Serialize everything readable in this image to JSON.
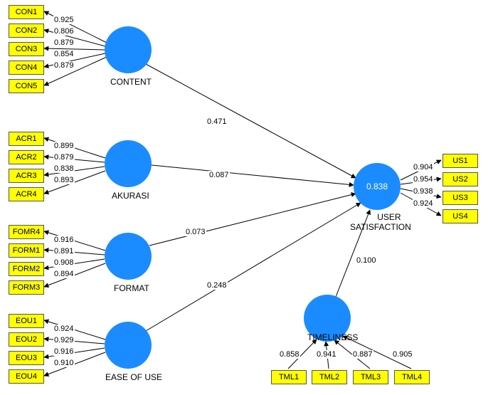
{
  "chart_data": {
    "type": "path-diagram",
    "latent_vars": [
      {
        "id": "content",
        "label": "CONTENT",
        "indicators": [
          {
            "name": "CON1",
            "loading": 0.925
          },
          {
            "name": "CON2",
            "loading": 0.806
          },
          {
            "name": "CON3",
            "loading": 0.879
          },
          {
            "name": "CON4",
            "loading": 0.854
          },
          {
            "name": "CON5",
            "loading": 0.879
          }
        ]
      },
      {
        "id": "akurasi",
        "label": "AKURASI",
        "indicators": [
          {
            "name": "ACR1",
            "loading": 0.899
          },
          {
            "name": "ACR2",
            "loading": 0.879
          },
          {
            "name": "ACR3",
            "loading": 0.838
          },
          {
            "name": "ACR4",
            "loading": 0.893
          }
        ]
      },
      {
        "id": "format",
        "label": "FORMAT",
        "indicators": [
          {
            "name": "FOMR4",
            "loading": 0.916
          },
          {
            "name": "FORM1",
            "loading": 0.891
          },
          {
            "name": "FORM2",
            "loading": 0.908
          },
          {
            "name": "FORM3",
            "loading": 0.894
          }
        ]
      },
      {
        "id": "ease_of_use",
        "label": "EASE OF USE",
        "indicators": [
          {
            "name": "EOU1",
            "loading": 0.924
          },
          {
            "name": "EOU2",
            "loading": 0.929
          },
          {
            "name": "EOU3",
            "loading": 0.916
          },
          {
            "name": "EOU4",
            "loading": 0.91
          }
        ]
      },
      {
        "id": "timeliness",
        "label": "TIMELINESS",
        "indicators": [
          {
            "name": "TML1",
            "loading": 0.858
          },
          {
            "name": "TML2",
            "loading": 0.941
          },
          {
            "name": "TML3",
            "loading": 0.887
          },
          {
            "name": "TML4",
            "loading": 0.905
          }
        ]
      },
      {
        "id": "user_satisfaction",
        "label": "USER SATISFACTION",
        "r2": 0.838,
        "indicators": [
          {
            "name": "US1",
            "loading": 0.904
          },
          {
            "name": "US2",
            "loading": 0.954
          },
          {
            "name": "US3",
            "loading": 0.938
          },
          {
            "name": "US4",
            "loading": 0.924
          }
        ]
      }
    ],
    "paths": [
      {
        "from": "content",
        "to": "user_satisfaction",
        "coef": 0.471
      },
      {
        "from": "akurasi",
        "to": "user_satisfaction",
        "coef": 0.087
      },
      {
        "from": "format",
        "to": "user_satisfaction",
        "coef": 0.073
      },
      {
        "from": "ease_of_use",
        "to": "user_satisfaction",
        "coef": 0.248
      },
      {
        "from": "timeliness",
        "to": "user_satisfaction",
        "coef": 0.1
      }
    ]
  },
  "labels": {
    "content": "CONTENT",
    "akurasi": "AKURASI",
    "format": "FORMAT",
    "ease_of_use": "EASE OF USE",
    "timeliness": "TIMELINESS",
    "user_satisfaction_line1": "USER",
    "user_satisfaction_line2": "SATISFACTION"
  },
  "r2": {
    "user_satisfaction": "0.838"
  },
  "indicators": {
    "CON1": "CON1",
    "CON2": "CON2",
    "CON3": "CON3",
    "CON4": "CON4",
    "CON5": "CON5",
    "ACR1": "ACR1",
    "ACR2": "ACR2",
    "ACR3": "ACR3",
    "ACR4": "ACR4",
    "FOMR4": "FOMR4",
    "FORM1": "FORM1",
    "FORM2": "FORM2",
    "FORM3": "FORM3",
    "EOU1": "EOU1",
    "EOU2": "EOU2",
    "EOU3": "EOU3",
    "EOU4": "EOU4",
    "TML1": "TML1",
    "TML2": "TML2",
    "TML3": "TML3",
    "TML4": "TML4",
    "US1": "US1",
    "US2": "US2",
    "US3": "US3",
    "US4": "US4"
  },
  "loadings": {
    "CON1": "0.925",
    "CON2": "0.806",
    "CON3": "0.879",
    "CON4": "0.854",
    "CON5": "0.879",
    "ACR1": "0.899",
    "ACR2": "0.879",
    "ACR3": "0.838",
    "ACR4": "0.893",
    "FOMR4": "0.916",
    "FORM1": "0.891",
    "FORM2": "0.908",
    "FORM3": "0.894",
    "EOU1": "0.924",
    "EOU2": "0.929",
    "EOU3": "0.916",
    "EOU4": "0.910",
    "TML1": "0.858",
    "TML2": "0.941",
    "TML3": "0.887",
    "TML4": "0.905",
    "US1": "0.904",
    "US2": "0.954",
    "US3": "0.938",
    "US4": "0.924"
  },
  "path_coefs": {
    "content": "0.471",
    "akurasi": "0.087",
    "format": "0.073",
    "ease_of_use": "0.248",
    "timeliness": "0.100"
  }
}
